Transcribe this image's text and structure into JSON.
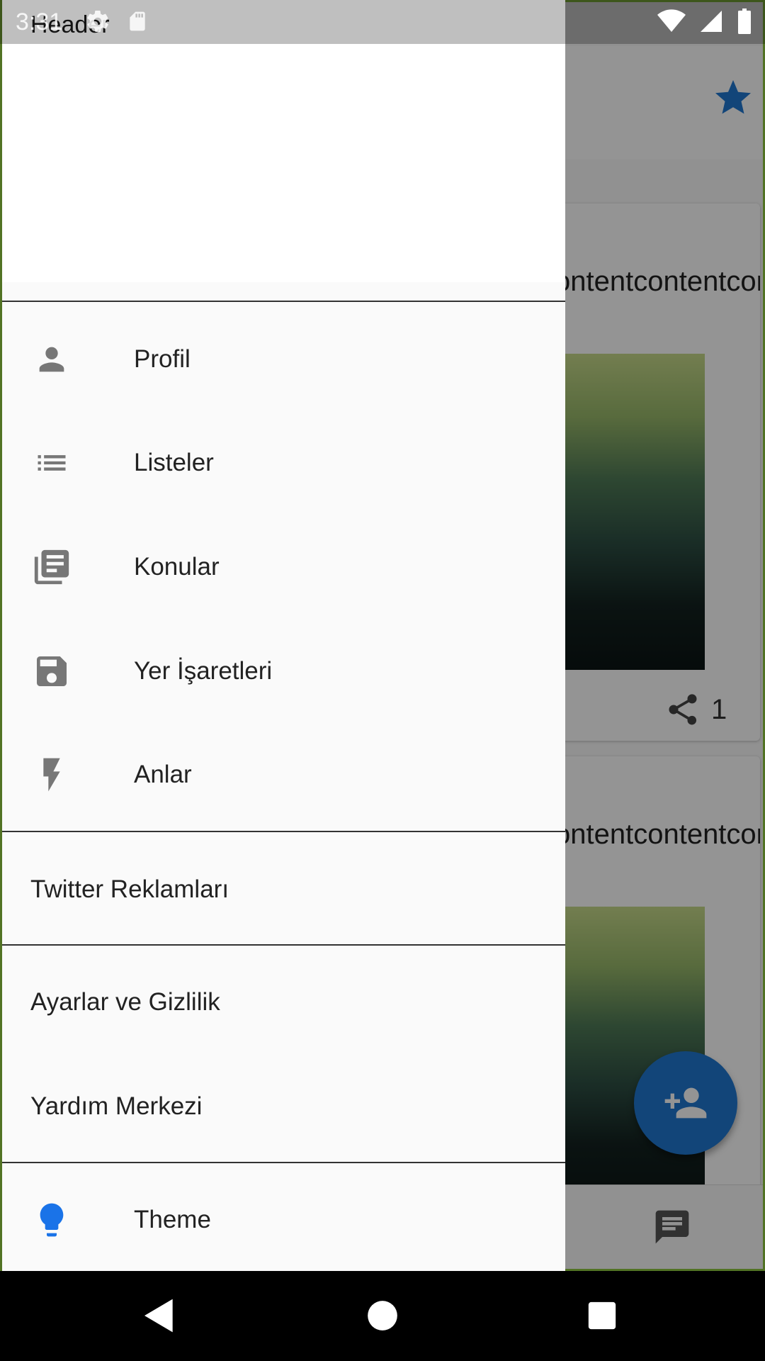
{
  "status_bar": {
    "time": "3:31"
  },
  "drawer": {
    "header_title": "Header",
    "items": [
      {
        "icon": "person-icon",
        "label": "Profil"
      },
      {
        "icon": "list-icon",
        "label": "Listeler"
      },
      {
        "icon": "topics-icon",
        "label": "Konular"
      },
      {
        "icon": "bookmark-save-icon",
        "label": "Yer İşaretleri"
      },
      {
        "icon": "flash-icon",
        "label": "Anlar"
      }
    ],
    "ads_label": "Twitter Reklamları",
    "settings_label": "Ayarlar ve Gizlilik",
    "help_label": "Yardım Merkezi",
    "theme_label": "Theme",
    "theme_icon_color": "#1a73e8"
  },
  "background": {
    "card_text": "contentcontentconte",
    "share_count": "1",
    "accent_color": "#1f77d0"
  }
}
